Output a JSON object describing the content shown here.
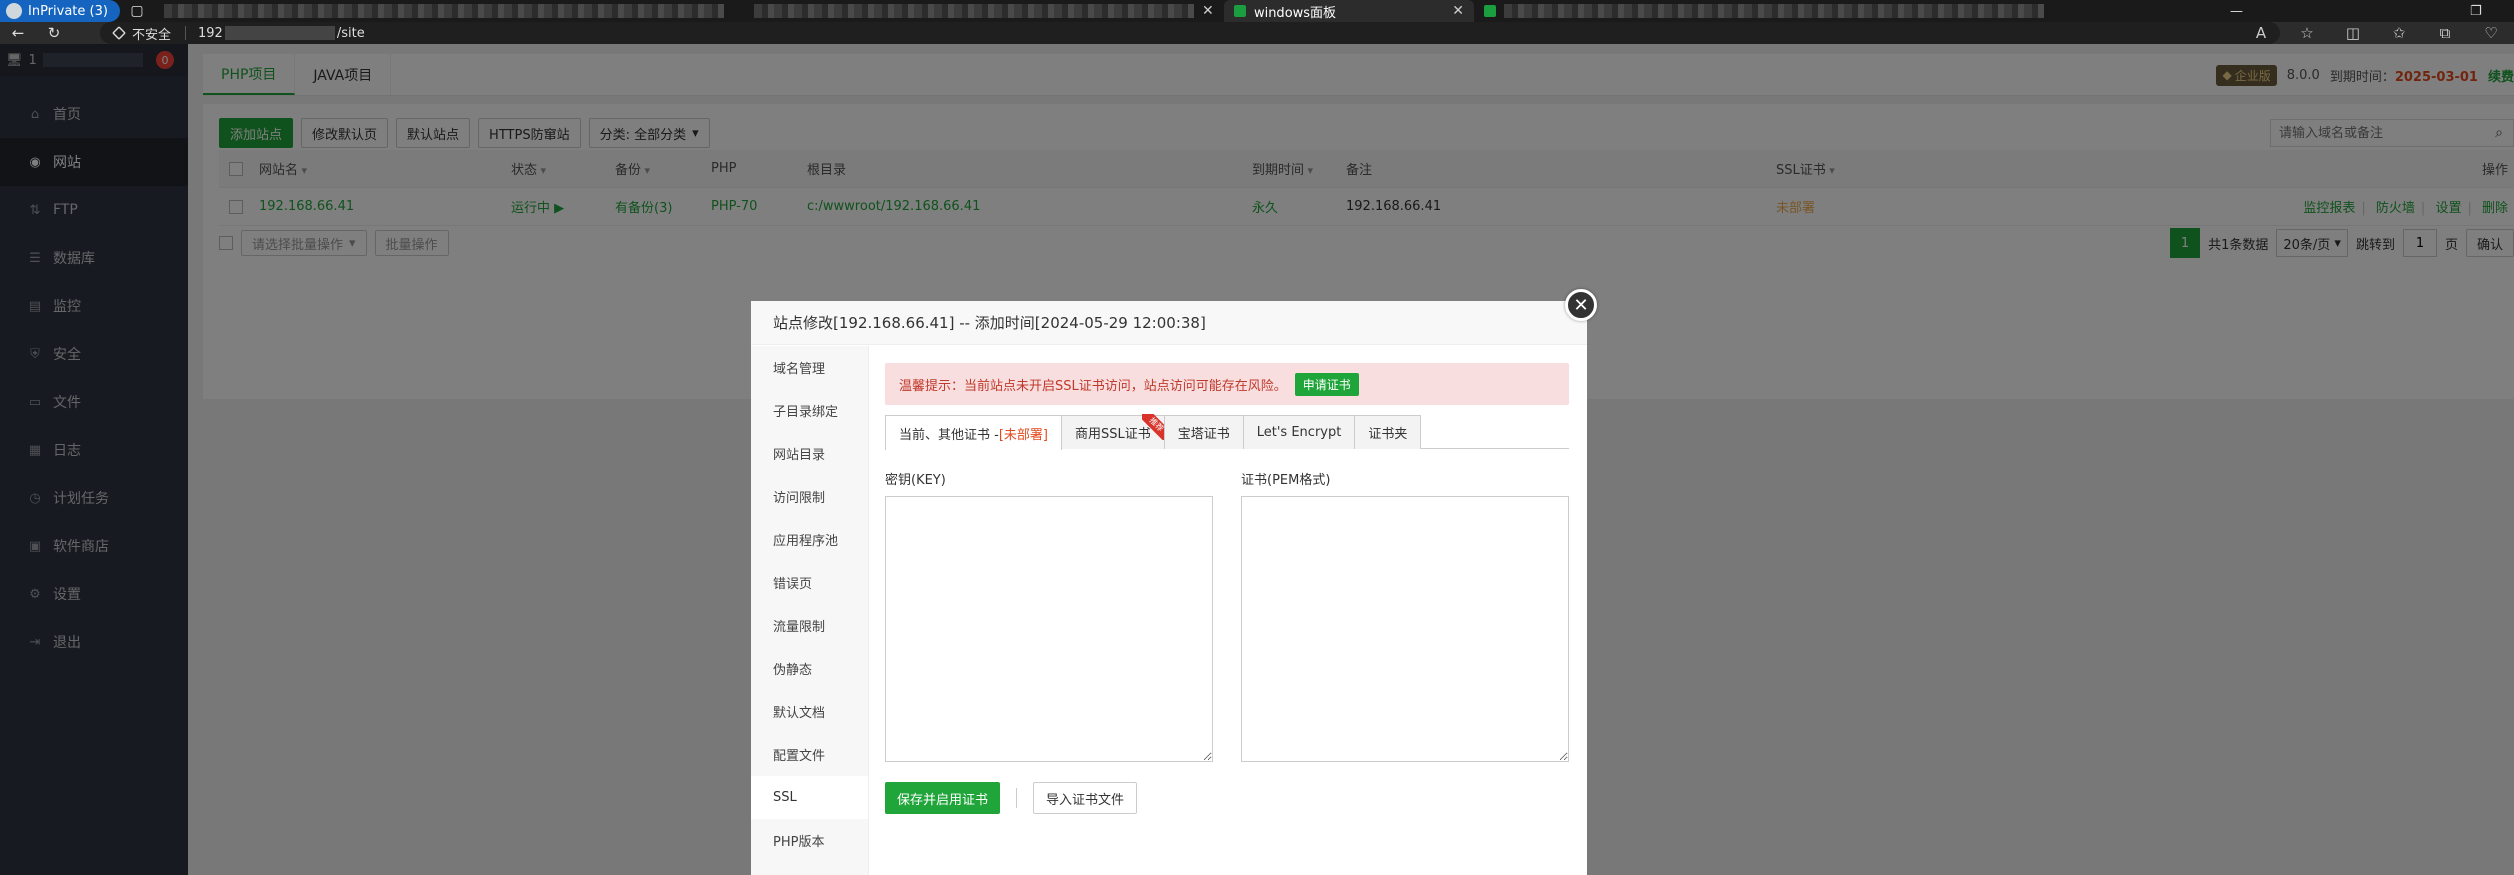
{
  "browser": {
    "inprivate_label": "InPrivate (3)",
    "active_tab_title": "windows面板",
    "security_label": "不安全",
    "url_prefix": "192",
    "url_suffix": "/site"
  },
  "sidebar": {
    "server_name": "1",
    "notification_count": "0",
    "items": [
      {
        "label": "首页",
        "icon": "home-icon"
      },
      {
        "label": "网站",
        "icon": "globe-icon"
      },
      {
        "label": "FTP",
        "icon": "ftp-icon"
      },
      {
        "label": "数据库",
        "icon": "database-icon"
      },
      {
        "label": "监控",
        "icon": "monitor-icon"
      },
      {
        "label": "安全",
        "icon": "shield-icon"
      },
      {
        "label": "文件",
        "icon": "folder-icon"
      },
      {
        "label": "日志",
        "icon": "log-icon"
      },
      {
        "label": "计划任务",
        "icon": "clock-icon"
      },
      {
        "label": "软件商店",
        "icon": "store-icon"
      },
      {
        "label": "设置",
        "icon": "gear-icon"
      },
      {
        "label": "退出",
        "icon": "logout-icon"
      }
    ]
  },
  "header": {
    "tabs": [
      "PHP项目",
      "JAVA项目"
    ],
    "edition": "企业版",
    "version": "8.0.0",
    "expire_label": "到期时间：",
    "expire_date": "2025-03-01",
    "renew": "续费"
  },
  "toolbar": {
    "add_site": "添加站点",
    "modify_default_page": "修改默认页",
    "default_site": "默认站点",
    "https_protect": "HTTPS防窜站",
    "category": "分类: 全部分类",
    "search_placeholder": "请输入域名或备注"
  },
  "table": {
    "headers": [
      "网站名",
      "状态",
      "备份",
      "PHP",
      "根目录",
      "到期时间",
      "备注",
      "SSL证书",
      "操作"
    ],
    "rows": [
      {
        "name": "192.168.66.41",
        "status": "运行中 ▶",
        "backup": "有备份(3)",
        "php": "PHP-70",
        "root": "c:/wwwroot/192.168.66.41",
        "expire": "永久",
        "note": "192.168.66.41",
        "ssl": "未部署",
        "ops": [
          "监控报表",
          "防火墙",
          "设置",
          "删除"
        ]
      }
    ]
  },
  "footer": {
    "batch_select": "请选择批量操作",
    "batch_button": "批量操作",
    "page": "1",
    "total": "共1条数据",
    "per_page": "20条/页",
    "goto_label": "跳转到",
    "goto_value": "1",
    "page_unit": "页",
    "confirm": "确认"
  },
  "modal": {
    "title": "站点修改[192.168.66.41] -- 添加时间[2024-05-29 12:00:38]",
    "nav": [
      "域名管理",
      "子目录绑定",
      "网站目录",
      "访问限制",
      "应用程序池",
      "错误页",
      "流量限制",
      "伪静态",
      "默认文档",
      "配置文件",
      "SSL",
      "PHP版本"
    ],
    "alert_text": "温馨提示：当前站点未开启SSL证书访问，站点访问可能存在风险。",
    "apply_cert": "申请证书",
    "ssl_tabs": {
      "current": "当前、其他证书 - ",
      "current_status": "[未部署]",
      "commercial": "商用SSL证书",
      "ribbon": "推荐",
      "baota": "宝塔证书",
      "letsencrypt": "Let's Encrypt",
      "folder": "证书夹"
    },
    "key_label": "密钥(KEY)",
    "cert_label": "证书(PEM格式)",
    "save_button": "保存并启用证书",
    "import_button": "导入证书文件"
  }
}
